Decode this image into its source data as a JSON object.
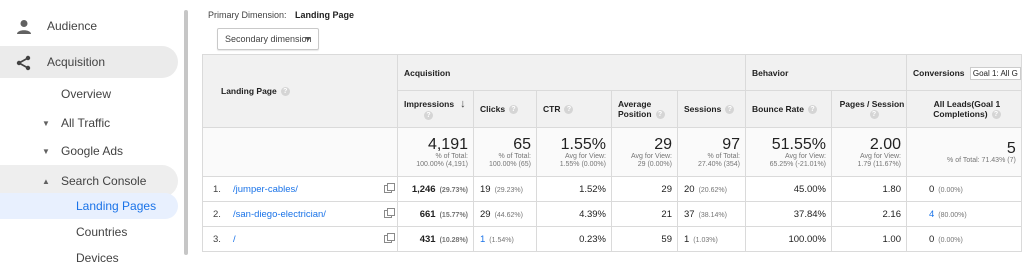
{
  "sidebar": {
    "audience_label": "Audience",
    "acquisition_label": "Acquisition",
    "overview_label": "Overview",
    "all_traffic_label": "All Traffic",
    "google_ads_label": "Google Ads",
    "search_console_label": "Search Console",
    "landing_pages_label": "Landing Pages",
    "countries_label": "Countries",
    "devices_label": "Devices"
  },
  "toolbar": {
    "primary_dimension_prefix": "Primary Dimension:",
    "primary_dimension_value": "Landing Page",
    "secondary_dimension_label": "Secondary dimension"
  },
  "table": {
    "landing_header": "Landing Page",
    "group_acquisition": "Acquisition",
    "group_behavior": "Behavior",
    "group_conversions": "Conversions",
    "goal_select": "Goal 1: All G",
    "columns": {
      "impressions": "Impressions",
      "clicks": "Clicks",
      "ctr": "CTR",
      "avg_position_1": "Average",
      "avg_position_2": "Position",
      "sessions": "Sessions",
      "bounce_rate": "Bounce Rate",
      "pages_session": "Pages / Session",
      "all_leads_1": "All Leads(Goal 1",
      "all_leads_2": "Completions)"
    },
    "totals": {
      "impressions": "4,191",
      "impressions_sub1": "% of Total:",
      "impressions_sub2": "100.00% (4,191)",
      "clicks": "65",
      "clicks_sub1": "% of Total:",
      "clicks_sub2": "100.00% (65)",
      "ctr": "1.55%",
      "ctr_sub1": "Avg for View:",
      "ctr_sub2": "1.55% (0.00%)",
      "position": "29",
      "position_sub1": "Avg for View:",
      "position_sub2": "29 (0.00%)",
      "sessions": "97",
      "sessions_sub1": "% of Total:",
      "sessions_sub2": "27.40% (354)",
      "bounce": "51.55%",
      "bounce_sub1": "Avg for View:",
      "bounce_sub2": "65.25% (-21.01%)",
      "pages": "2.00",
      "pages_sub1": "Avg for View:",
      "pages_sub2": "1.79 (11.67%)",
      "leads": "5",
      "leads_sub": "% of Total: 71.43% (7)"
    },
    "rows": [
      {
        "idx": "1.",
        "page": "/jumper-cables/",
        "impressions": "1,246",
        "impressions_pct": "(29.73%)",
        "clicks": "19",
        "clicks_pct": "(29.23%)",
        "ctr": "1.52%",
        "position": "29",
        "sessions": "20",
        "sessions_pct": "(20.62%)",
        "bounce": "45.00%",
        "pages": "1.80",
        "leads": "0",
        "leads_pct": "(0.00%)"
      },
      {
        "idx": "2.",
        "page": "/san-diego-electrician/",
        "impressions": "661",
        "impressions_pct": "(15.77%)",
        "clicks": "29",
        "clicks_pct": "(44.62%)",
        "ctr": "4.39%",
        "position": "21",
        "sessions": "37",
        "sessions_pct": "(38.14%)",
        "bounce": "37.84%",
        "pages": "2.16",
        "leads": "4",
        "leads_pct": "(80.00%)"
      },
      {
        "idx": "3.",
        "page": "/",
        "impressions": "431",
        "impressions_pct": "(10.28%)",
        "clicks": "1",
        "clicks_pct": "(1.54%)",
        "ctr": "0.23%",
        "position": "59",
        "sessions": "1",
        "sessions_pct": "(1.03%)",
        "bounce": "100.00%",
        "pages": "1.00",
        "leads": "0",
        "leads_pct": "(0.00%)"
      }
    ]
  }
}
